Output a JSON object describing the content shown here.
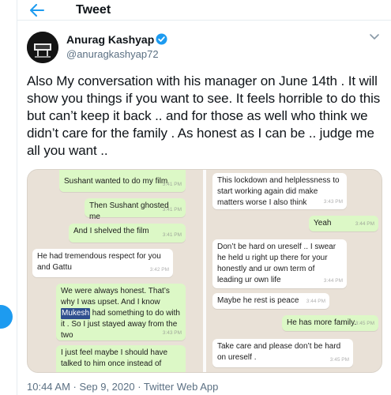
{
  "header": {
    "title": "Tweet",
    "back_icon": "arrow-left-icon"
  },
  "author": {
    "name": "Anurag Kashyap",
    "handle": "@anuragkashyap72",
    "verified_icon": "verified-badge-icon",
    "menu_icon": "chevron-down-icon"
  },
  "tweet": {
    "text": "Also My conversation with his manager on June 14th . It will show you things if you want to see. It feels horrible to do this but can’t keep it back .. and for those as well who think we didn’t care for the family . As honest as I can be .. judge me all you want .."
  },
  "screenshot_left": {
    "messages": [
      {
        "text": "Sushant wanted to do my film",
        "time": "3:41 PM"
      },
      {
        "text": "Then Sushant ghosted me",
        "time": "3:41 PM"
      },
      {
        "text": "And I shelved the film",
        "time": "3:41 PM"
      },
      {
        "text": "He had tremendous respect for you and Gattu",
        "time": "3:42 PM"
      },
      {
        "text_before": "We were always honest. That’s why I was upset. And I know ",
        "redacted": "Mukesh",
        "text_after": " had something to do with it . So I just stayed away from the two",
        "time": "3:43 PM"
      },
      {
        "text": "I just feel maybe I should have talked to him once instead of"
      }
    ]
  },
  "screenshot_right": {
    "messages": [
      {
        "text": "This lockdown and helplessness to start working again did make matters worse I also think",
        "time": "3:43 PM"
      },
      {
        "text": "Yeah",
        "time": "3:44 PM"
      },
      {
        "text": "Don’t be hard on ureself .. I swear he held u right up there for your honestly and ur own term of leading ur own life",
        "time": "3:44 PM"
      },
      {
        "text": "Maybe he rest is peace",
        "time": "3:44 PM"
      },
      {
        "text": "He has more family.",
        "time": "3:45 PM"
      },
      {
        "text": "Take care and please don’t be hard on ureself .",
        "time": "3:45 PM"
      }
    ]
  },
  "meta": {
    "timestamp": "10:44 AM · Sep 9, 2020 · Twitter Web App"
  },
  "colors": {
    "accent": "#1d9bf0",
    "outgoing_bubble": "#dcf8c6",
    "incoming_bubble": "#ffffff",
    "chat_background": "#e9e1d7"
  }
}
